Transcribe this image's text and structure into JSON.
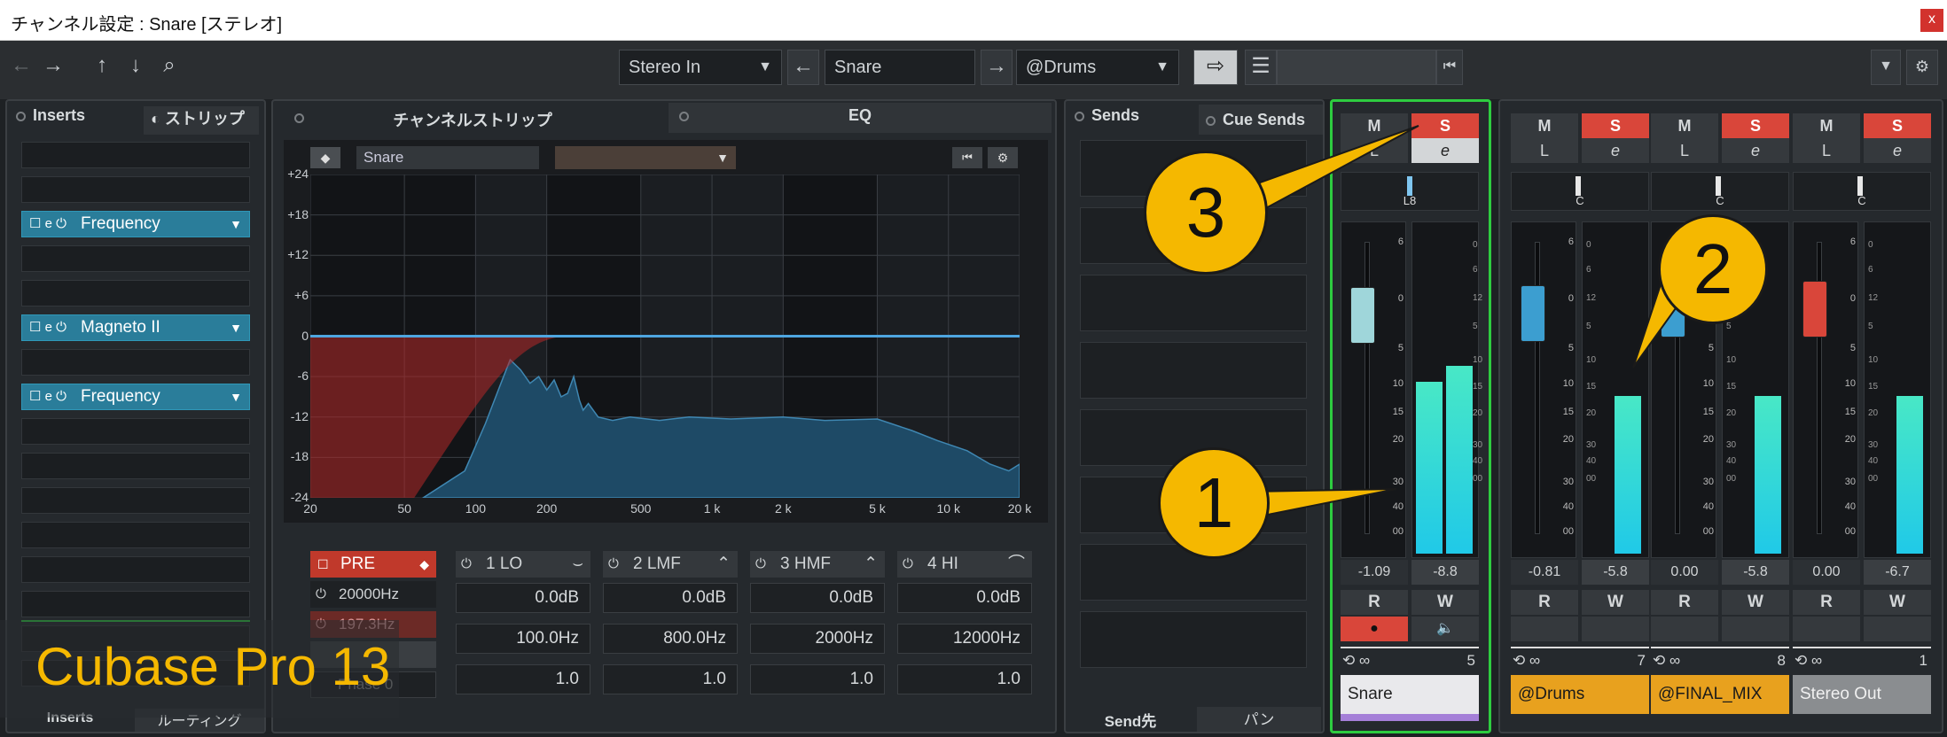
{
  "window": {
    "title": "チャンネル設定 : Snare [ステレオ]",
    "close": "x"
  },
  "toolbar": {
    "back": "←",
    "forward": "→",
    "up": "↑",
    "down": "↓",
    "search": "⌕",
    "input_routing": "Stereo In",
    "left_arrow": "←",
    "channel_name": "Snare",
    "right_arrow": "→",
    "output_routing": "@Drums",
    "route_icon": "⇨",
    "snap": "⏮",
    "menu_arrow": "▼"
  },
  "left_panel": {
    "tab_inserts": "Inserts",
    "tab_strip": "ストリップ",
    "bottom_inserts": "Inserts",
    "bottom_routing": "ルーティング",
    "plugins": [
      {
        "slot": 2,
        "name": "Frequency"
      },
      {
        "slot": 5,
        "name": "Magneto II"
      },
      {
        "slot": 7,
        "name": "Frequency"
      }
    ]
  },
  "center_panel": {
    "tab_strip": "チャンネルストリップ",
    "tab_eq": "EQ",
    "eq_preset": "Snare",
    "db_labels": [
      "+24",
      "+18",
      "+12",
      "+6",
      "0",
      "-6",
      "-12",
      "-18",
      "-24"
    ],
    "freq_labels": [
      "20",
      "50",
      "100",
      "200",
      "500",
      "1 k",
      "2 k",
      "5 k",
      "10 k",
      "20 k"
    ],
    "pre": {
      "label": "PRE",
      "hp_freq": "20000Hz",
      "lp_freq": "197.3Hz",
      "phase": "Phase 0"
    },
    "bands": [
      {
        "name": "1 LO",
        "gain": "0.0dB",
        "freq": "100.0Hz",
        "q": "1.0"
      },
      {
        "name": "2 LMF",
        "gain": "0.0dB",
        "freq": "800.0Hz",
        "q": "1.0"
      },
      {
        "name": "3 HMF",
        "gain": "0.0dB",
        "freq": "2000Hz",
        "q": "1.0"
      },
      {
        "name": "4 HI",
        "gain": "0.0dB",
        "freq": "12000Hz",
        "q": "1.0"
      }
    ]
  },
  "sends_panel": {
    "tab_sends": "Sends",
    "tab_cue": "Cue Sends",
    "bottom_send": "Send先",
    "bottom_pan": "パン"
  },
  "fader_scale": [
    "6",
    "0",
    "5",
    "10",
    "15",
    "20",
    "30",
    "40",
    "00"
  ],
  "meter_scale": [
    "0",
    "6",
    "12",
    "5",
    "10",
    "15",
    "20",
    "30",
    "40",
    "00"
  ],
  "channels": [
    {
      "id": "snare",
      "m": "M",
      "s": "S",
      "l": "L",
      "e": "e",
      "pan": "L8",
      "fader": "-1.09",
      "peak": "-8.8",
      "r": "R",
      "w": "W",
      "num": "5",
      "name": "Snare",
      "color": "#e9e9ec",
      "text_color": "#222",
      "accent": "#a57fd8",
      "fader_color": "#9fd6da",
      "meter_level": 0.85
    },
    {
      "id": "drums",
      "m": "M",
      "s": "S",
      "l": "L",
      "e": "e",
      "pan": "C",
      "fader": "-0.81",
      "peak": "-5.8",
      "r": "R",
      "w": "W",
      "num": "7",
      "name": "@Drums",
      "color": "#e8a11e",
      "text_color": "#1a1a1a",
      "fader_color": "#3c9ed0",
      "meter_level": 0.78
    },
    {
      "id": "finalmix",
      "m": "M",
      "s": "S",
      "l": "L",
      "e": "e",
      "pan": "C",
      "fader": "0.00",
      "peak": "-5.8",
      "r": "R",
      "w": "W",
      "num": "8",
      "name": "@FINAL_MIX",
      "color": "#e8a11e",
      "text_color": "#1a1a1a",
      "fader_color": "#3c9ed0",
      "meter_level": 0.78
    },
    {
      "id": "stereoout",
      "m": "M",
      "s": "S",
      "l": "L",
      "e": "e",
      "pan": "C",
      "fader": "0.00",
      "peak": "-6.7",
      "r": "R",
      "w": "W",
      "num": "1",
      "name": "Stereo Out",
      "color": "#8a8d90",
      "text_color": "#f0f0f0",
      "fader_color": "#d9463a",
      "meter_level": 0.78
    }
  ],
  "callouts": [
    "1",
    "2",
    "3"
  ],
  "watermark": "Cubase Pro 13",
  "colors": {
    "accent_cyan": "#2bd9d0",
    "solo_red": "#d9463a",
    "select_green": "#2ecc40",
    "plugin_blue": "#2a7d9a"
  }
}
